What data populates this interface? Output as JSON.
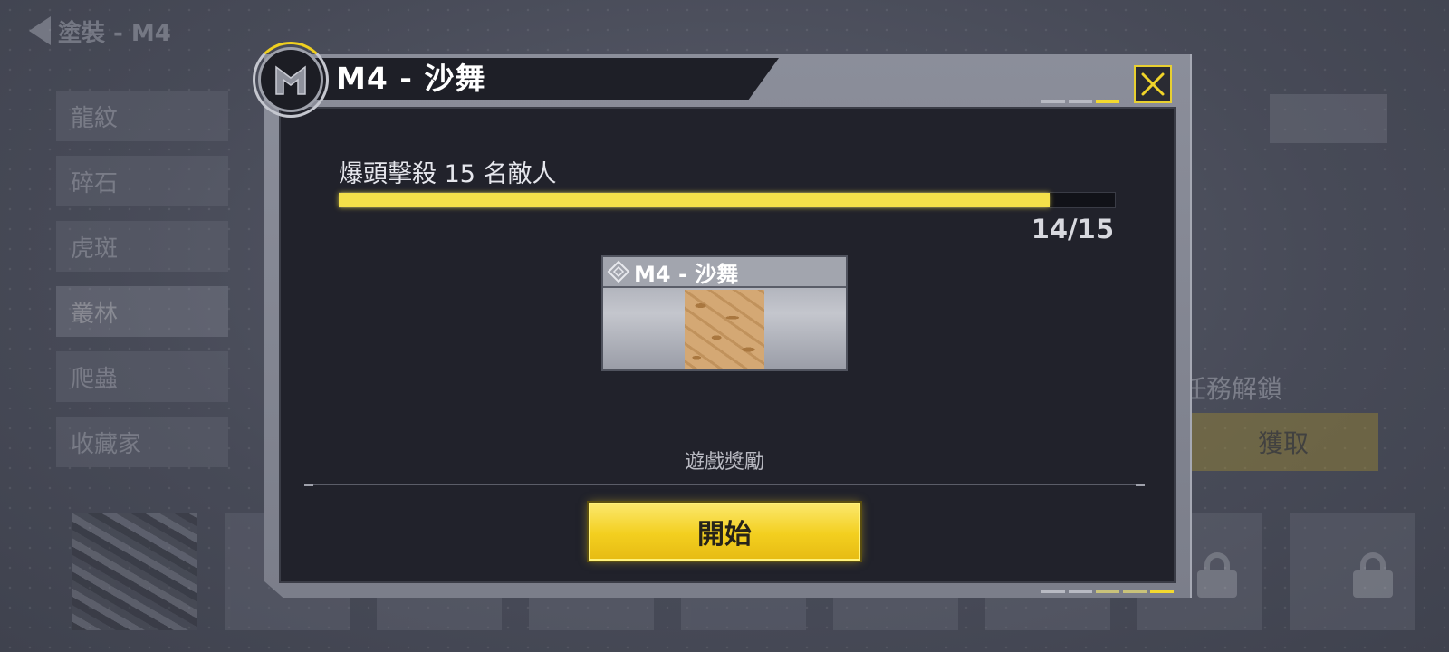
{
  "background": {
    "back_title": "塗裝 - M4",
    "categories": [
      "龍紋",
      "碎石",
      "虎斑",
      "叢林",
      "爬蟲",
      "收藏家"
    ],
    "selected_category": "叢林",
    "unlock_label": "任務解鎖",
    "get_button": "獲取"
  },
  "modal": {
    "title": "M4 - 沙舞",
    "emblem_icon": "faction-m-emblem-icon",
    "close_icon": "close-x-icon",
    "task": {
      "description": "爆頭擊殺 15 名敵人",
      "progress_text": "14/15",
      "current": 14,
      "total": 15
    },
    "reward": {
      "name": "M4 - 沙舞",
      "rarity_icon": "diamond-rarity-icon",
      "swatch": "desert-sand-camo"
    },
    "reward_caption": "遊戲獎勵",
    "start_button": "開始",
    "colors": {
      "accent": "#f3d92e",
      "progress_fill": "#f4e04a",
      "panel": "#21222b",
      "camo_base": "#d4a874",
      "camo_pattern": "#a9773f"
    }
  }
}
